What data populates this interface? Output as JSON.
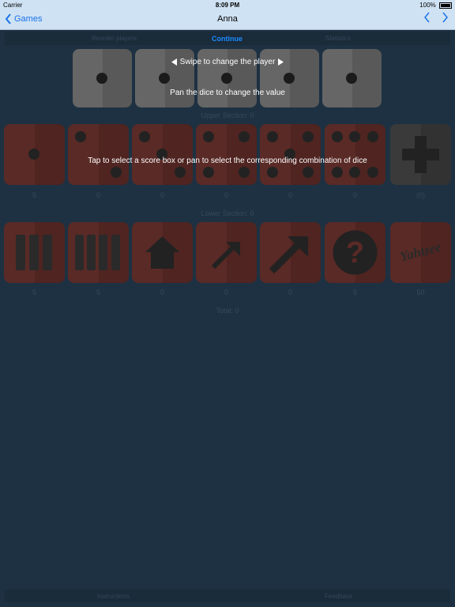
{
  "status_bar": {
    "carrier": "Carrier",
    "time": "8:09 PM",
    "battery": "100%"
  },
  "nav": {
    "back_label": "Games",
    "title": "Anna"
  },
  "top_bar": {
    "reorder_label": "Reorder players",
    "continue_label": "Continue",
    "statistics_label": "Statistics"
  },
  "hints": {
    "swipe": "Swipe to change the player",
    "pan": "Pan the dice to change the value",
    "tap": "Tap to select a score box or pan to select the corresponding combination of dice"
  },
  "upper_section": {
    "title": "Upper Section: 0",
    "scores": [
      "5",
      "0",
      "0",
      "0",
      "0",
      "0",
      "(0)"
    ]
  },
  "lower_section": {
    "title": "Lower Section: 0",
    "scores": [
      "5",
      "5",
      "0",
      "0",
      "0",
      "5",
      "50"
    ],
    "yahtzee_label": "Yahtzee"
  },
  "total": "Total: 0",
  "bottom_bar": {
    "instructions_label": "Instructions",
    "feedback_label": "Feedback"
  },
  "colors": {
    "accent": "#1a8cff",
    "nav_bg": "#cfe2f3",
    "page_bg": "#1d3142",
    "die_red": "#5a2a26",
    "die_gray": "#666666"
  }
}
